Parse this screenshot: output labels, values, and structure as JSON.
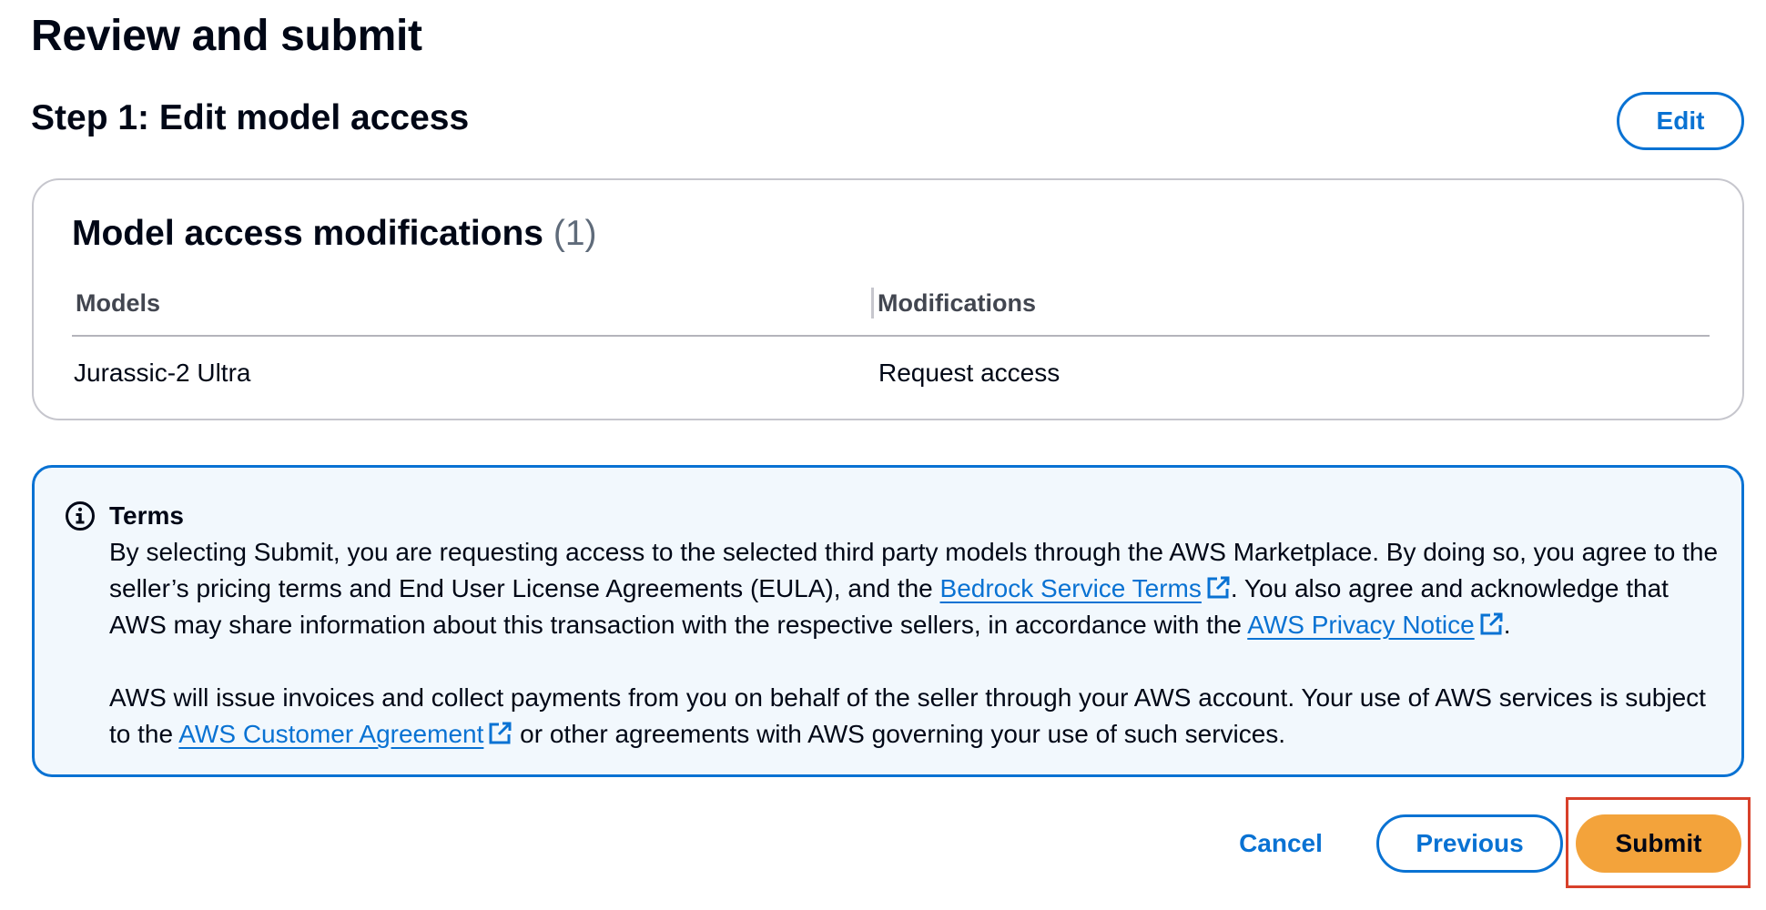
{
  "page": {
    "title": "Review and submit"
  },
  "step1": {
    "title": "Step 1: Edit model access",
    "edit_label": "Edit"
  },
  "modifications": {
    "title": "Model access modifications",
    "count": "(1)",
    "columns": [
      "Models",
      "Modifications"
    ],
    "rows": [
      {
        "model": "Jurassic-2 Ultra",
        "modification": "Request access"
      }
    ]
  },
  "terms": {
    "icon": "info-icon",
    "title": "Terms",
    "p1_part1": "By selecting Submit, you are requesting access to the selected third party models through the AWS Marketplace. By doing so, you agree to the seller’s pricing terms and End User License Agreements (EULA), and the ",
    "link_bedrock": "Bedrock Service Terms",
    "p1_part2": ". You also agree and acknowledge that AWS may share information about this transaction with the respective sellers, in accordance with the ",
    "link_privacy": "AWS Privacy Notice",
    "p1_part3": ".",
    "p2_part1": "AWS will issue invoices and collect payments from you on behalf of the seller through your AWS account. Your use of AWS services is subject to the ",
    "link_customer": "AWS Customer Agreement",
    "p2_part2": " or other agreements with AWS governing your use of such services."
  },
  "actions": {
    "cancel_label": "Cancel",
    "previous_label": "Previous",
    "submit_label": "Submit"
  },
  "colors": {
    "primary": "#0972d3",
    "submit": "#f3a33b",
    "highlight": "#d8402a",
    "alert_bg": "#f2f8fd"
  }
}
